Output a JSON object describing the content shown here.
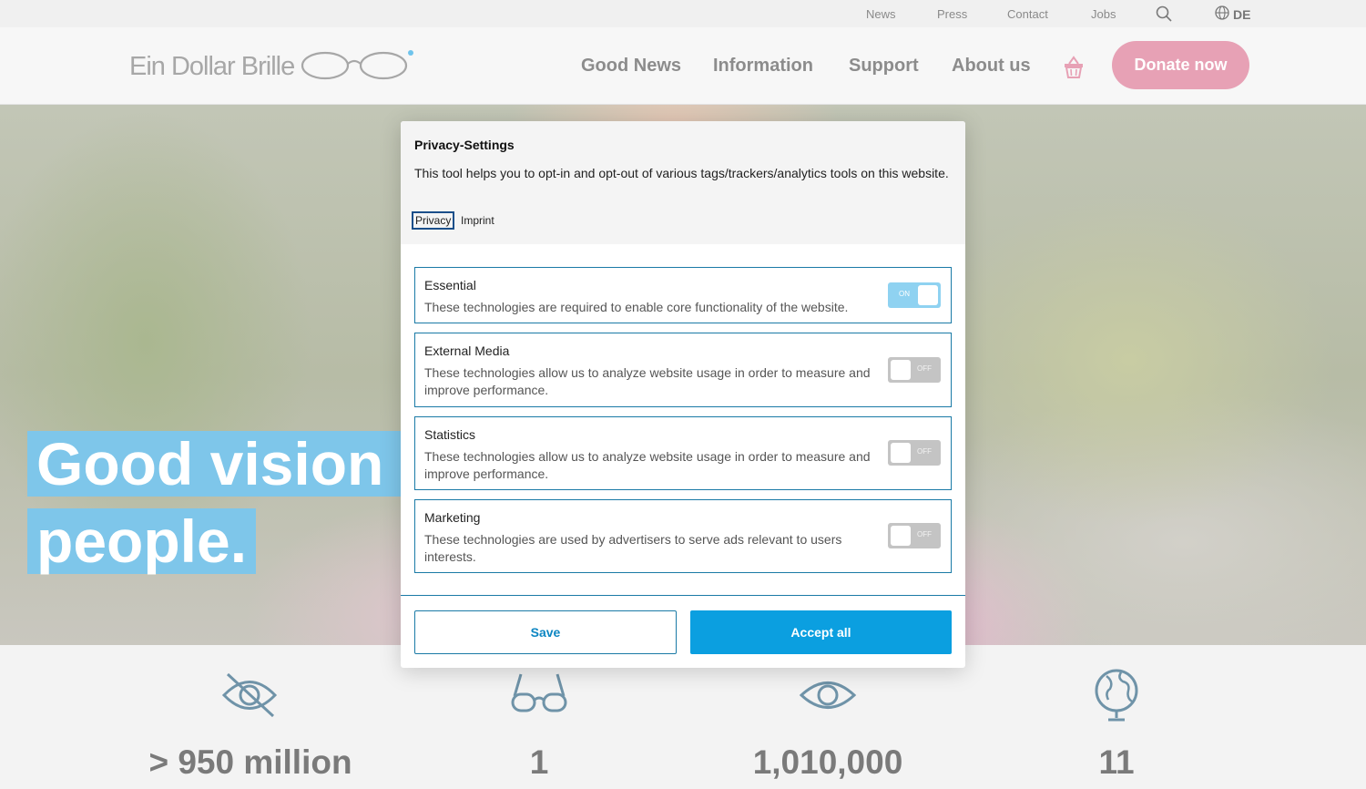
{
  "topbar": {
    "links": [
      "News",
      "Press",
      "Contact",
      "Jobs"
    ],
    "language": "DE"
  },
  "header": {
    "logo_text": "Ein Dollar Brille",
    "nav": [
      "Good News",
      "Information",
      "Support",
      "About us"
    ],
    "donate_label": "Donate now"
  },
  "hero": {
    "line1": "Good vision f",
    "line2": "people."
  },
  "stats": {
    "values": [
      "> 950 million",
      "1",
      "1,010,000",
      "11"
    ]
  },
  "privacy": {
    "title": "Privacy-Settings",
    "description": "This tool helps you to opt-in and opt-out of various tags/trackers/analytics tools on this website.",
    "links": [
      "Privacy",
      "Imprint"
    ],
    "categories": [
      {
        "title": "Essential",
        "description": "These technologies are required to enable core functionality of the website.",
        "state": "ON"
      },
      {
        "title": "External Media",
        "description": "These technologies allow us to analyze website usage in order to measure and improve performance.",
        "state": "OFF"
      },
      {
        "title": "Statistics",
        "description": "These technologies allow us to analyze website usage in order to measure and improve performance.",
        "state": "OFF"
      },
      {
        "title": "Marketing",
        "description": "These technologies are used by advertisers to serve ads relevant to users interests.",
        "state": "OFF"
      }
    ],
    "save_label": "Save",
    "accept_label": "Accept all"
  },
  "colors": {
    "accent": "#0b9fe0",
    "border": "#1a7aa6",
    "donate": "#e7a1b5",
    "hero_highlight": "#7ec6ea"
  }
}
